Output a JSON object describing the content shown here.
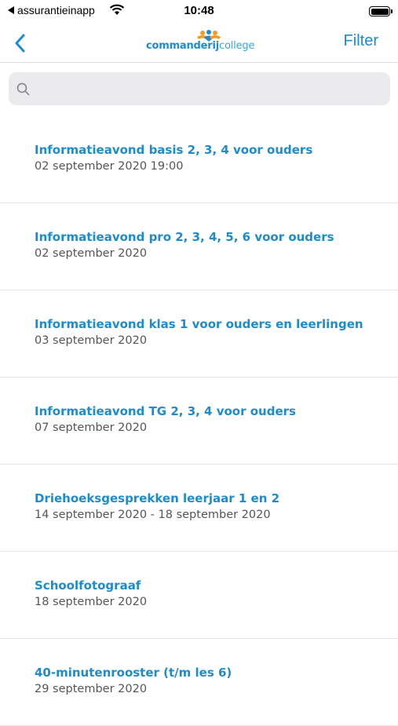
{
  "status_bar": {
    "back_app": "assurantieinapp",
    "time": "10:48",
    "battery_level": 1.0
  },
  "nav": {
    "logo_bold": "commanderij",
    "logo_light": "college",
    "filter_label": "Filter"
  },
  "search": {
    "placeholder": ""
  },
  "colors": {
    "accent": "#1a8ccf",
    "logo_orange": "#f39c1f",
    "search_bg": "#ebebed"
  },
  "events": [
    {
      "title": "Informatieavond basis 2, 3, 4 voor ouders",
      "date": "02 september 2020 19:00"
    },
    {
      "title": "Informatieavond pro 2, 3, 4, 5, 6 voor ouders",
      "date": "02 september 2020"
    },
    {
      "title": "Informatieavond klas 1 voor ouders en leerlingen",
      "date": "03 september 2020"
    },
    {
      "title": "Informatieavond TG 2, 3, 4 voor ouders",
      "date": "07 september 2020"
    },
    {
      "title": "Driehoeksgesprekken leerjaar 1 en 2",
      "date": "14 september 2020 - 18 september 2020"
    },
    {
      "title": "Schoolfotograaf",
      "date": "18 september 2020"
    },
    {
      "title": "40-minutenrooster (t/m les 6)",
      "date": "29 september 2020"
    }
  ]
}
